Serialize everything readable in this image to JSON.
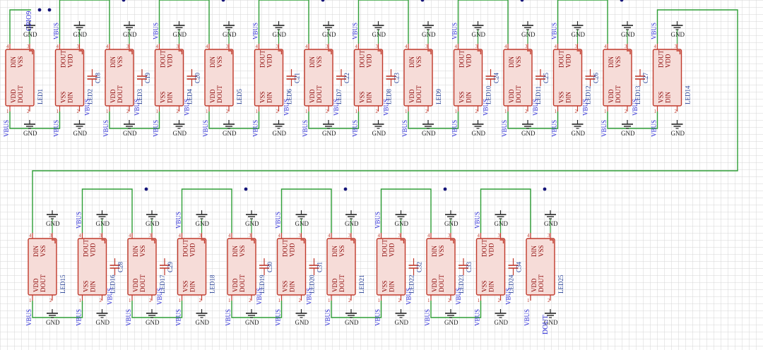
{
  "colors": {
    "grid": "#d6d6d6",
    "wire": "#2e9e36",
    "body_fill": "#f6dcd8",
    "body_stroke": "#c0392b",
    "pin_text": "#8a0000",
    "ref_text": "#1f3a93",
    "net_text": "#2b2bd6",
    "gnd": "#222222",
    "junction": "#16167a"
  },
  "labels": {
    "vbus": "VBUS",
    "gnd": "GND",
    "pin_din": "DIN",
    "pin_dout": "DOUT",
    "pin_vdd": "VDD",
    "pin_vss": "VSS",
    "gpio": "GPIO9",
    "dout_out": "DOUT"
  },
  "rows": [
    {
      "leds": [
        {
          "ref": "LED1",
          "orient": "a"
        },
        {
          "ref": "LED2",
          "orient": "b"
        },
        {
          "ref": "LED3",
          "orient": "a"
        },
        {
          "ref": "LED4",
          "orient": "b"
        },
        {
          "ref": "LED5",
          "orient": "a"
        },
        {
          "ref": "LED6",
          "orient": "b"
        },
        {
          "ref": "LED7",
          "orient": "a"
        },
        {
          "ref": "LED8",
          "orient": "b"
        },
        {
          "ref": "LED9",
          "orient": "a"
        },
        {
          "ref": "LED10",
          "orient": "b"
        },
        {
          "ref": "LED11",
          "orient": "a"
        },
        {
          "ref": "LED12",
          "orient": "b"
        },
        {
          "ref": "LED13",
          "orient": "a"
        },
        {
          "ref": "LED14",
          "orient": "b"
        }
      ],
      "caps": [
        "C18",
        "C19",
        "C20",
        "C21",
        "C22",
        "C23",
        "C24",
        "C25",
        "C26",
        "C27"
      ]
    },
    {
      "leds": [
        {
          "ref": "LED15",
          "orient": "a"
        },
        {
          "ref": "LED16",
          "orient": "b"
        },
        {
          "ref": "LED17",
          "orient": "a"
        },
        {
          "ref": "LED18",
          "orient": "b"
        },
        {
          "ref": "LED19",
          "orient": "a"
        },
        {
          "ref": "LED20",
          "orient": "b"
        },
        {
          "ref": "LED21",
          "orient": "a"
        },
        {
          "ref": "LED22",
          "orient": "b"
        },
        {
          "ref": "LED23",
          "orient": "a"
        },
        {
          "ref": "LED24",
          "orient": "b"
        },
        {
          "ref": "LED25",
          "orient": "a"
        }
      ],
      "caps": [
        "C28",
        "C29",
        "C30",
        "C31",
        "C32",
        "C33",
        "C34"
      ]
    }
  ]
}
